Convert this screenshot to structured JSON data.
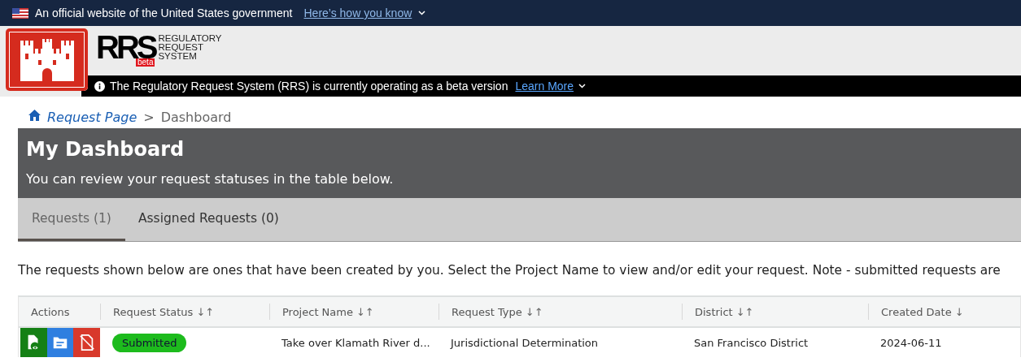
{
  "gov_banner": {
    "text": "An official website of the United States government",
    "link": "Here’s how you know"
  },
  "header": {
    "logo_mark": "RRS",
    "logo_badge": "beta",
    "logo_lines": [
      "REGULATORY",
      "REQUEST",
      "SYSTEM"
    ],
    "notice": "The Regulatory Request System (RRS) is currently operating as a beta version",
    "notice_link": "Learn More"
  },
  "breadcrumb": {
    "items": [
      {
        "label": "Request Page",
        "kind": "link"
      },
      {
        "label": "Dashboard",
        "kind": "current"
      }
    ],
    "separator": ">"
  },
  "dashboard": {
    "title": "My Dashboard",
    "subtitle": "You can review your request statuses in the table below."
  },
  "tabs": [
    {
      "label": "Requests (1)",
      "selected": true
    },
    {
      "label": "Assigned Requests (0)",
      "selected": false
    }
  ],
  "intro": "The requests shown below are ones that have been created by you. Select the Project Name to view and/or edit your request. Note - submitted requests are",
  "table": {
    "columns": [
      {
        "label": "Actions"
      },
      {
        "label": "Request Status",
        "sort": "↓↑"
      },
      {
        "label": "Project Name",
        "sort": "↓↑"
      },
      {
        "label": "Request Type",
        "sort": "↓↑"
      },
      {
        "label": "District",
        "sort": "↓↑"
      },
      {
        "label": "Created Date",
        "sort": "↓"
      }
    ],
    "rows": [
      {
        "actions": [
          {
            "kind": "view",
            "color": "#158015"
          },
          {
            "kind": "edit",
            "color": "#2f7fe0"
          },
          {
            "kind": "delete",
            "color": "#d8392b"
          }
        ],
        "status": "Submitted",
        "project": "Take over Klamath River d...",
        "type": "Jurisdictional Determination",
        "district": "San Francisco District",
        "created": "2024-06-11"
      }
    ]
  }
}
